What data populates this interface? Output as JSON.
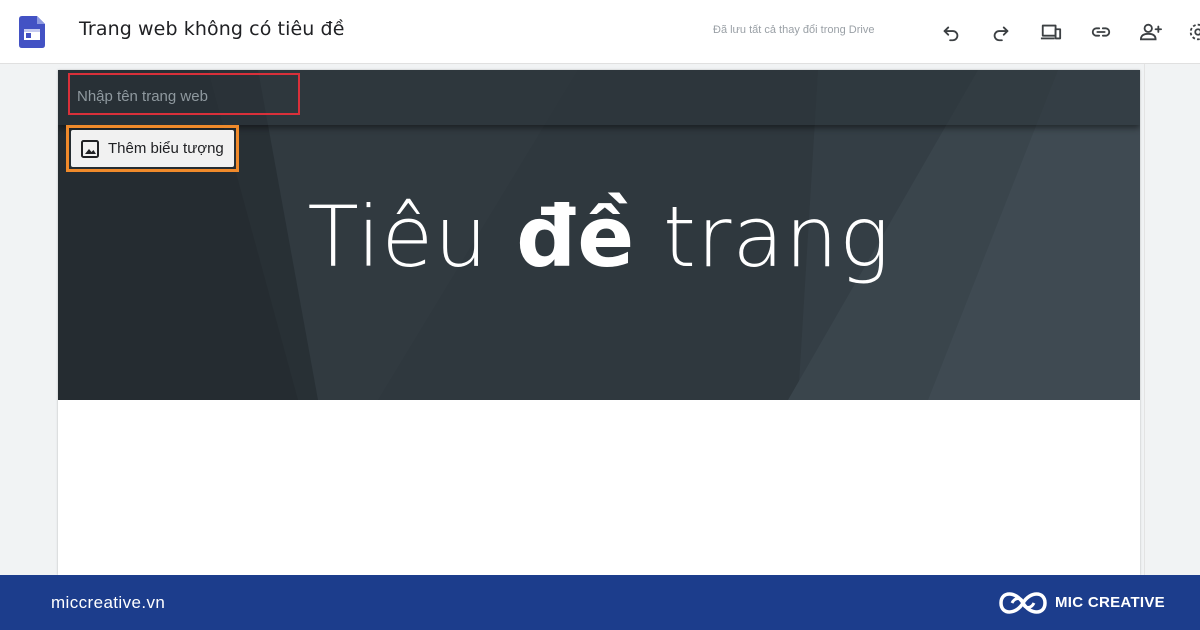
{
  "appbar": {
    "title": "Trang web không có tiêu đề",
    "save_status": "Đã lưu tất cả thay đổi trong Drive",
    "tools": [
      "undo-icon",
      "redo-icon",
      "preview-devices-icon",
      "link-icon",
      "add-person-icon",
      "gear-icon"
    ]
  },
  "header": {
    "site_name_placeholder": "Nhập tên trang web",
    "add_logo_label": "Thêm biểu tượng"
  },
  "banner": {
    "title_light_1": "Tiêu ",
    "title_bold": "đề",
    "title_light_2": " trang"
  },
  "footer": {
    "url": "miccreative.vn",
    "brand": "MIC CREATIVE"
  },
  "colors": {
    "app_logo": "#4352c4",
    "banner_bg": "#2f383e",
    "site_name_highlight": "#d9303a",
    "logo_button_highlight": "#f08a2b",
    "footer_bg": "#1c3d8c"
  }
}
